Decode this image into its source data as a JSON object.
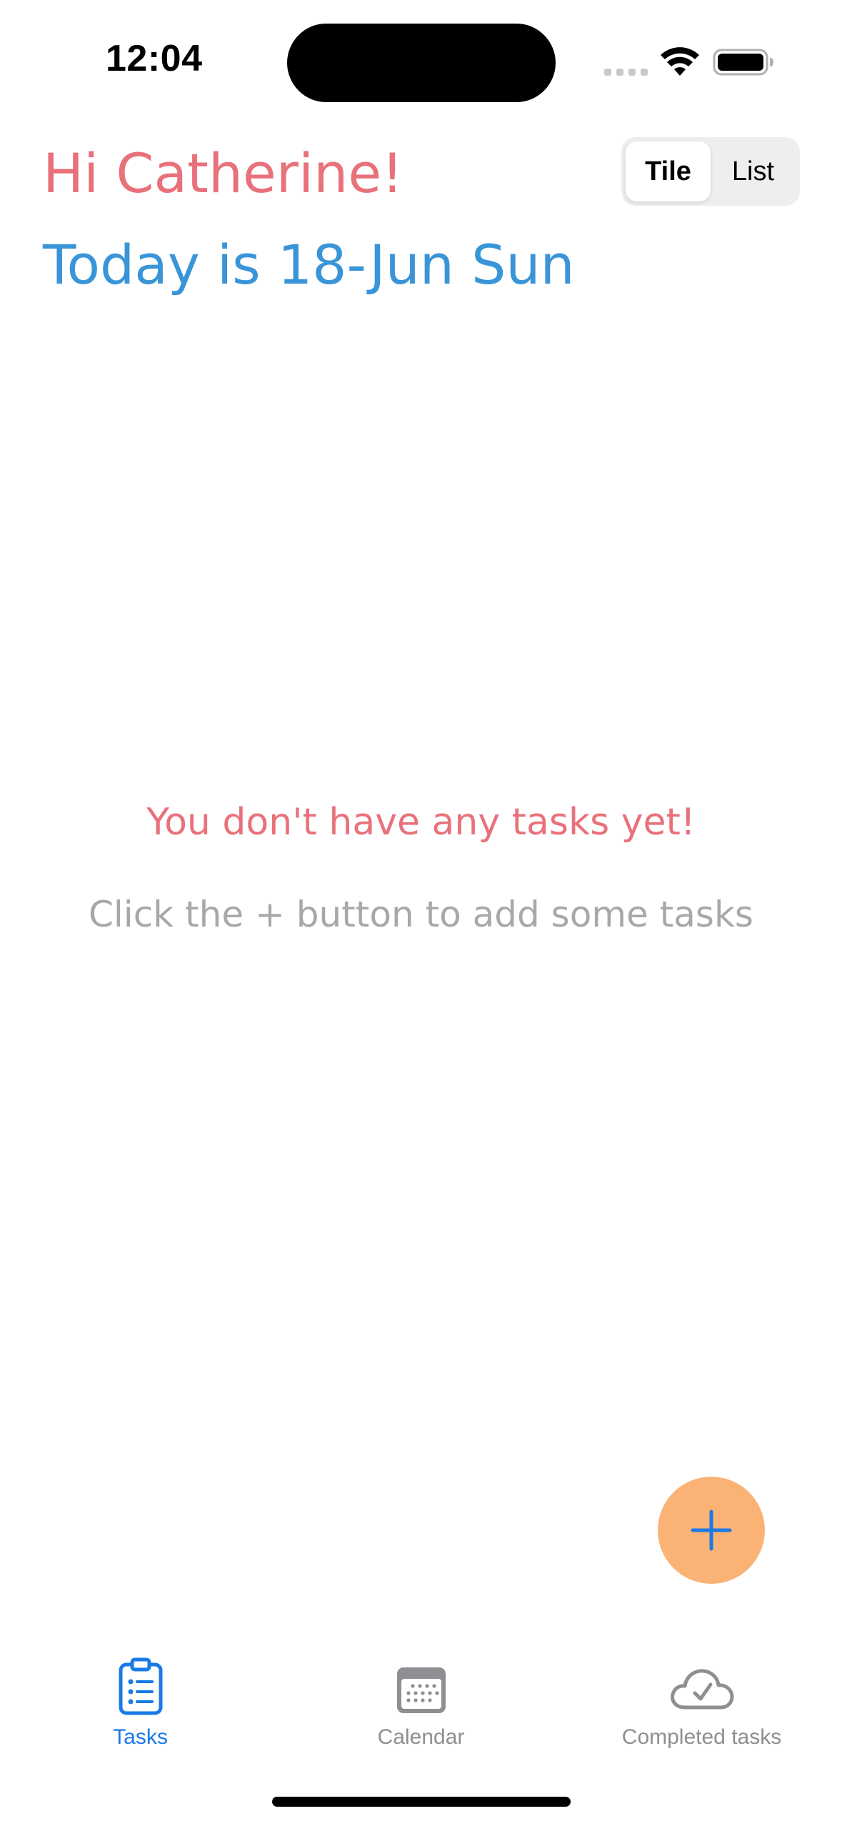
{
  "status_bar": {
    "time": "12:04",
    "icons": [
      "cellular-signal-icon",
      "wifi-icon",
      "battery-icon"
    ]
  },
  "header": {
    "greeting": "Hi Catherine!",
    "date_line": "Today is 18-Jun Sun"
  },
  "view_toggle": {
    "options": [
      "Tile",
      "List"
    ],
    "selected": "Tile"
  },
  "empty_state": {
    "title": "You don't have any tasks yet!",
    "subtitle": "Click the + button to add some tasks"
  },
  "fab": {
    "icon": "plus-icon"
  },
  "tab_bar": {
    "items": [
      {
        "label": "Tasks",
        "icon": "clipboard-list-icon",
        "active": true
      },
      {
        "label": "Calendar",
        "icon": "calendar-icon",
        "active": false
      },
      {
        "label": "Completed tasks",
        "icon": "cloud-check-icon",
        "active": false
      }
    ]
  },
  "colors": {
    "greeting": "#e8717b",
    "date": "#3a95d8",
    "empty_title": "#e8717b",
    "empty_subtitle": "#a8a8a8",
    "fab_background": "#fbb275",
    "fab_icon": "#1a7ae6",
    "tab_active": "#1a7ae6",
    "tab_inactive": "#8e8e93"
  }
}
